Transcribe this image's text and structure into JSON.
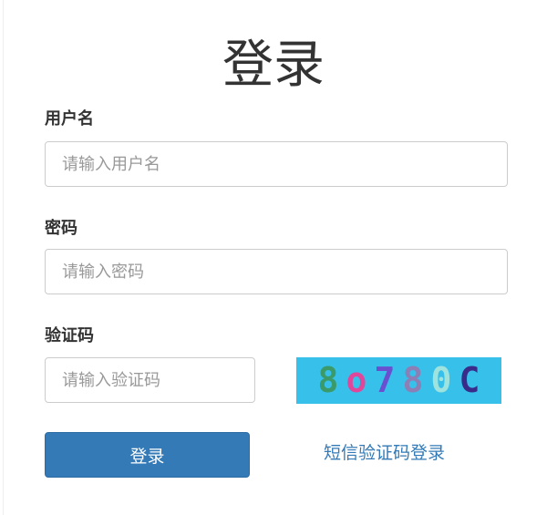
{
  "form": {
    "title": "登录",
    "username": {
      "label": "用户名",
      "placeholder": "请输入用户名",
      "value": ""
    },
    "password": {
      "label": "密码",
      "placeholder": "请输入密码",
      "value": ""
    },
    "captcha": {
      "label": "验证码",
      "placeholder": "请输入验证码",
      "value": "",
      "image_text": "8o780C",
      "image_background": "#36c0ea",
      "char_colors": [
        "#3a9a6a",
        "#e0479a",
        "#6a4fd0",
        "#8b7fb5",
        "#9fe3df",
        "#3a2a8a"
      ]
    },
    "submit_label": "登录",
    "sms_login_link": "短信验证码登录"
  },
  "colors": {
    "primary": "#337ab7",
    "text": "#333333",
    "border": "#cccccc",
    "placeholder": "#999999"
  }
}
